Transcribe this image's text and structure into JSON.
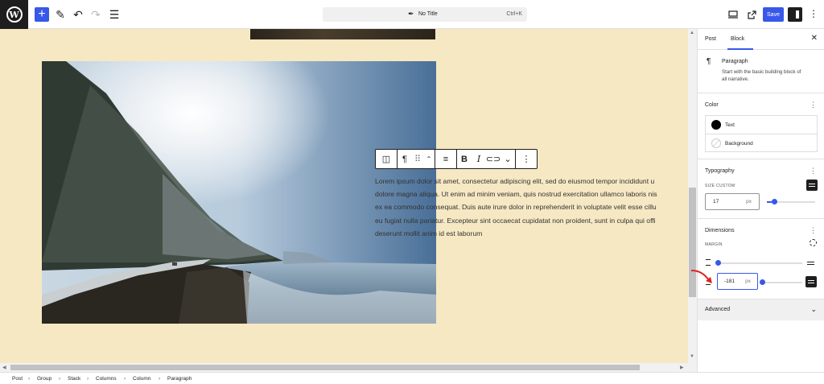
{
  "topbar": {
    "document_title": "No Title",
    "shortcut": "Ctrl+K",
    "save_label": "Save"
  },
  "canvas": {
    "paragraph_lines": [
      "Lorem ipsum dolor sit amet, consectetur adipiscing elit, sed do eiusmod tempor incididunt u",
      "dolore magna aliqua. Ut enim ad minim veniam, quis nostrud exercitation ullamco laboris nis",
      "ex ea commodo consequat. Duis aute irure dolor in reprehenderit in voluptate velit esse cillu",
      "eu fugiat nulla pariatur. Excepteur sint occaecat cupidatat non proident, sunt in culpa qui offi",
      "deserunt mollit anim id est laborum"
    ]
  },
  "sidebar": {
    "tabs": [
      "Post",
      "Block"
    ],
    "active_tab": "Block",
    "block": {
      "name": "Paragraph",
      "description_lines": [
        "Start with the basic building block of",
        "all narrative."
      ]
    },
    "color": {
      "label": "Color",
      "items": [
        {
          "label": "Text",
          "swatch": "#000000"
        },
        {
          "label": "Background",
          "swatch": "none"
        }
      ]
    },
    "typography": {
      "label": "Typography",
      "size_label": "SIZE",
      "size_mode": "CUSTOM",
      "size_value": "17",
      "size_unit": "px",
      "slider_fraction": 0.1
    },
    "dimensions": {
      "label": "Dimensions",
      "margin_label": "MARGIN",
      "margin_value": "-181",
      "margin_unit": "px",
      "top_slider_fraction": 0.0,
      "bottom_slider_fraction": 0.1
    },
    "advanced_label": "Advanced"
  },
  "breadcrumb": [
    "Post",
    "Group",
    "Stack",
    "Columns",
    "Column",
    "Paragraph"
  ],
  "colors": {
    "accent": "#3858e9",
    "canvas_bg": "#f6e8c3",
    "dark": "#1e1e1e"
  }
}
